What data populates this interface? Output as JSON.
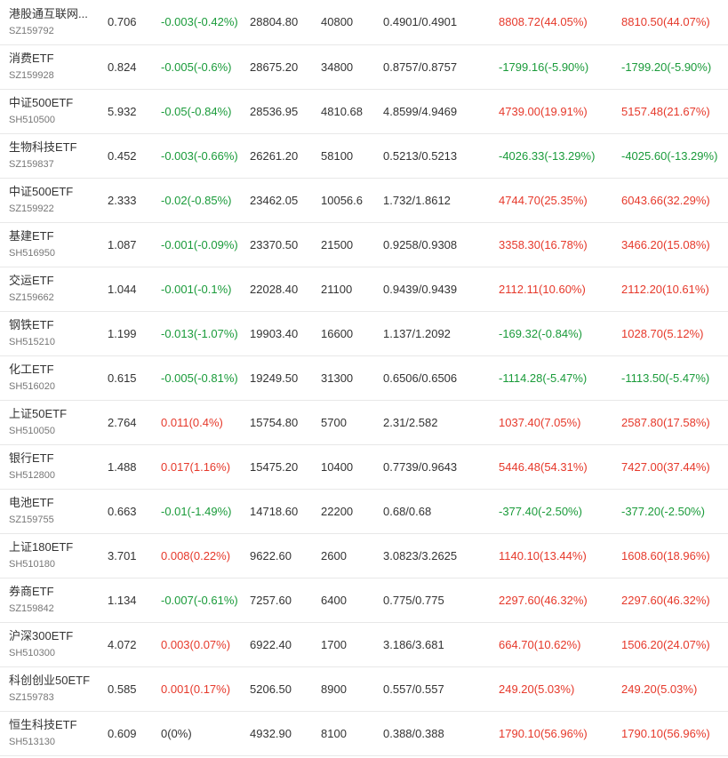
{
  "colors": {
    "up": "#e6392b",
    "down": "#1a9b3a",
    "flat": "#333333"
  },
  "rows": [
    {
      "name": "港股通互联网...",
      "code": "SZ159792",
      "price": "0.706",
      "change": "-0.003(-0.42%)",
      "change_dir": "down",
      "amount": "28804.80",
      "volume": "40800",
      "range": "0.4901/0.4901",
      "v1": "8808.72(44.05%)",
      "v1_dir": "up",
      "v2": "8810.50(44.07%)",
      "v2_dir": "up"
    },
    {
      "name": "消费ETF",
      "code": "SZ159928",
      "price": "0.824",
      "change": "-0.005(-0.6%)",
      "change_dir": "down",
      "amount": "28675.20",
      "volume": "34800",
      "range": "0.8757/0.8757",
      "v1": "-1799.16(-5.90%)",
      "v1_dir": "down",
      "v2": "-1799.20(-5.90%)",
      "v2_dir": "down"
    },
    {
      "name": "中证500ETF",
      "code": "SH510500",
      "price": "5.932",
      "change": "-0.05(-0.84%)",
      "change_dir": "down",
      "amount": "28536.95",
      "volume": "4810.68",
      "range": "4.8599/4.9469",
      "v1": "4739.00(19.91%)",
      "v1_dir": "up",
      "v2": "5157.48(21.67%)",
      "v2_dir": "up"
    },
    {
      "name": "生物科技ETF",
      "code": "SZ159837",
      "price": "0.452",
      "change": "-0.003(-0.66%)",
      "change_dir": "down",
      "amount": "26261.20",
      "volume": "58100",
      "range": "0.5213/0.5213",
      "v1": "-4026.33(-13.29%)",
      "v1_dir": "down",
      "v2": "-4025.60(-13.29%)",
      "v2_dir": "down"
    },
    {
      "name": "中证500ETF",
      "code": "SZ159922",
      "price": "2.333",
      "change": "-0.02(-0.85%)",
      "change_dir": "down",
      "amount": "23462.05",
      "volume": "10056.6",
      "range": "1.732/1.8612",
      "v1": "4744.70(25.35%)",
      "v1_dir": "up",
      "v2": "6043.66(32.29%)",
      "v2_dir": "up"
    },
    {
      "name": "基建ETF",
      "code": "SH516950",
      "price": "1.087",
      "change": "-0.001(-0.09%)",
      "change_dir": "down",
      "amount": "23370.50",
      "volume": "21500",
      "range": "0.9258/0.9308",
      "v1": "3358.30(16.78%)",
      "v1_dir": "up",
      "v2": "3466.20(15.08%)",
      "v2_dir": "up"
    },
    {
      "name": "交运ETF",
      "code": "SZ159662",
      "price": "1.044",
      "change": "-0.001(-0.1%)",
      "change_dir": "down",
      "amount": "22028.40",
      "volume": "21100",
      "range": "0.9439/0.9439",
      "v1": "2112.11(10.60%)",
      "v1_dir": "up",
      "v2": "2112.20(10.61%)",
      "v2_dir": "up"
    },
    {
      "name": "钢铁ETF",
      "code": "SH515210",
      "price": "1.199",
      "change": "-0.013(-1.07%)",
      "change_dir": "down",
      "amount": "19903.40",
      "volume": "16600",
      "range": "1.137/1.2092",
      "v1": "-169.32(-0.84%)",
      "v1_dir": "down",
      "v2": "1028.70(5.12%)",
      "v2_dir": "up"
    },
    {
      "name": "化工ETF",
      "code": "SH516020",
      "price": "0.615",
      "change": "-0.005(-0.81%)",
      "change_dir": "down",
      "amount": "19249.50",
      "volume": "31300",
      "range": "0.6506/0.6506",
      "v1": "-1114.28(-5.47%)",
      "v1_dir": "down",
      "v2": "-1113.50(-5.47%)",
      "v2_dir": "down"
    },
    {
      "name": "上证50ETF",
      "code": "SH510050",
      "price": "2.764",
      "change": "0.011(0.4%)",
      "change_dir": "up",
      "amount": "15754.80",
      "volume": "5700",
      "range": "2.31/2.582",
      "v1": "1037.40(7.05%)",
      "v1_dir": "up",
      "v2": "2587.80(17.58%)",
      "v2_dir": "up"
    },
    {
      "name": "银行ETF",
      "code": "SH512800",
      "price": "1.488",
      "change": "0.017(1.16%)",
      "change_dir": "up",
      "amount": "15475.20",
      "volume": "10400",
      "range": "0.7739/0.9643",
      "v1": "5446.48(54.31%)",
      "v1_dir": "up",
      "v2": "7427.00(37.44%)",
      "v2_dir": "up"
    },
    {
      "name": "电池ETF",
      "code": "SZ159755",
      "price": "0.663",
      "change": "-0.01(-1.49%)",
      "change_dir": "down",
      "amount": "14718.60",
      "volume": "22200",
      "range": "0.68/0.68",
      "v1": "-377.40(-2.50%)",
      "v1_dir": "down",
      "v2": "-377.20(-2.50%)",
      "v2_dir": "down"
    },
    {
      "name": "上证180ETF",
      "code": "SH510180",
      "price": "3.701",
      "change": "0.008(0.22%)",
      "change_dir": "up",
      "amount": "9622.60",
      "volume": "2600",
      "range": "3.0823/3.2625",
      "v1": "1140.10(13.44%)",
      "v1_dir": "up",
      "v2": "1608.60(18.96%)",
      "v2_dir": "up"
    },
    {
      "name": "券商ETF",
      "code": "SZ159842",
      "price": "1.134",
      "change": "-0.007(-0.61%)",
      "change_dir": "down",
      "amount": "7257.60",
      "volume": "6400",
      "range": "0.775/0.775",
      "v1": "2297.60(46.32%)",
      "v1_dir": "up",
      "v2": "2297.60(46.32%)",
      "v2_dir": "up"
    },
    {
      "name": "沪深300ETF",
      "code": "SH510300",
      "price": "4.072",
      "change": "0.003(0.07%)",
      "change_dir": "up",
      "amount": "6922.40",
      "volume": "1700",
      "range": "3.186/3.681",
      "v1": "664.70(10.62%)",
      "v1_dir": "up",
      "v2": "1506.20(24.07%)",
      "v2_dir": "up"
    },
    {
      "name": "科创创业50ETF",
      "code": "SZ159783",
      "price": "0.585",
      "change": "0.001(0.17%)",
      "change_dir": "up",
      "amount": "5206.50",
      "volume": "8900",
      "range": "0.557/0.557",
      "v1": "249.20(5.03%)",
      "v1_dir": "up",
      "v2": "249.20(5.03%)",
      "v2_dir": "up"
    },
    {
      "name": "恒生科技ETF",
      "code": "SH513130",
      "price": "0.609",
      "change": "0(0%)",
      "change_dir": "flat",
      "amount": "4932.90",
      "volume": "8100",
      "range": "0.388/0.388",
      "v1": "1790.10(56.96%)",
      "v1_dir": "up",
      "v2": "1790.10(56.96%)",
      "v2_dir": "up"
    }
  ]
}
